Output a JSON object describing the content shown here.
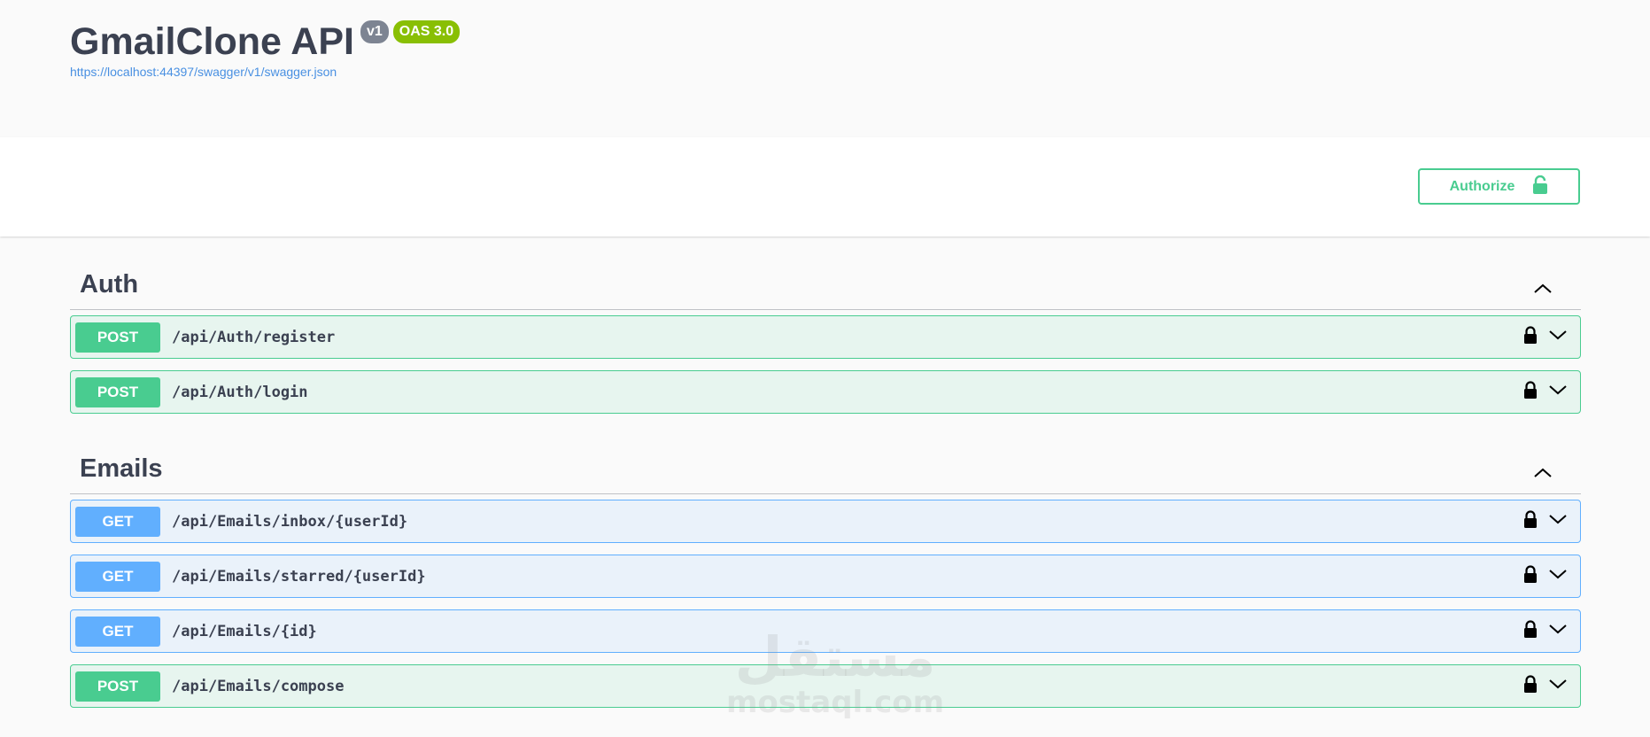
{
  "info": {
    "title": "GmailClone API",
    "version_badge": "v1",
    "oas_badge": "OAS 3.0",
    "spec_url": "https://localhost:44397/swagger/v1/swagger.json"
  },
  "authorize": {
    "label": "Authorize",
    "icon": "unlocked-padlock-icon"
  },
  "tags": [
    {
      "name": "Auth",
      "expanded": true,
      "operations": [
        {
          "method": "POST",
          "path": "/api/Auth/register"
        },
        {
          "method": "POST",
          "path": "/api/Auth/login"
        }
      ]
    },
    {
      "name": "Emails",
      "expanded": true,
      "operations": [
        {
          "method": "GET",
          "path": "/api/Emails/inbox/{userId}"
        },
        {
          "method": "GET",
          "path": "/api/Emails/starred/{userId}"
        },
        {
          "method": "GET",
          "path": "/api/Emails/{id}"
        },
        {
          "method": "POST",
          "path": "/api/Emails/compose"
        }
      ]
    }
  ],
  "watermark": {
    "logo": "مستقل",
    "text": "mostaql.com"
  },
  "colors": {
    "post": "#49cc90",
    "get": "#61affe",
    "text": "#3b4151",
    "link": "#4990e2",
    "version_badge": "#7d8492",
    "oas_badge": "#89bf04"
  }
}
